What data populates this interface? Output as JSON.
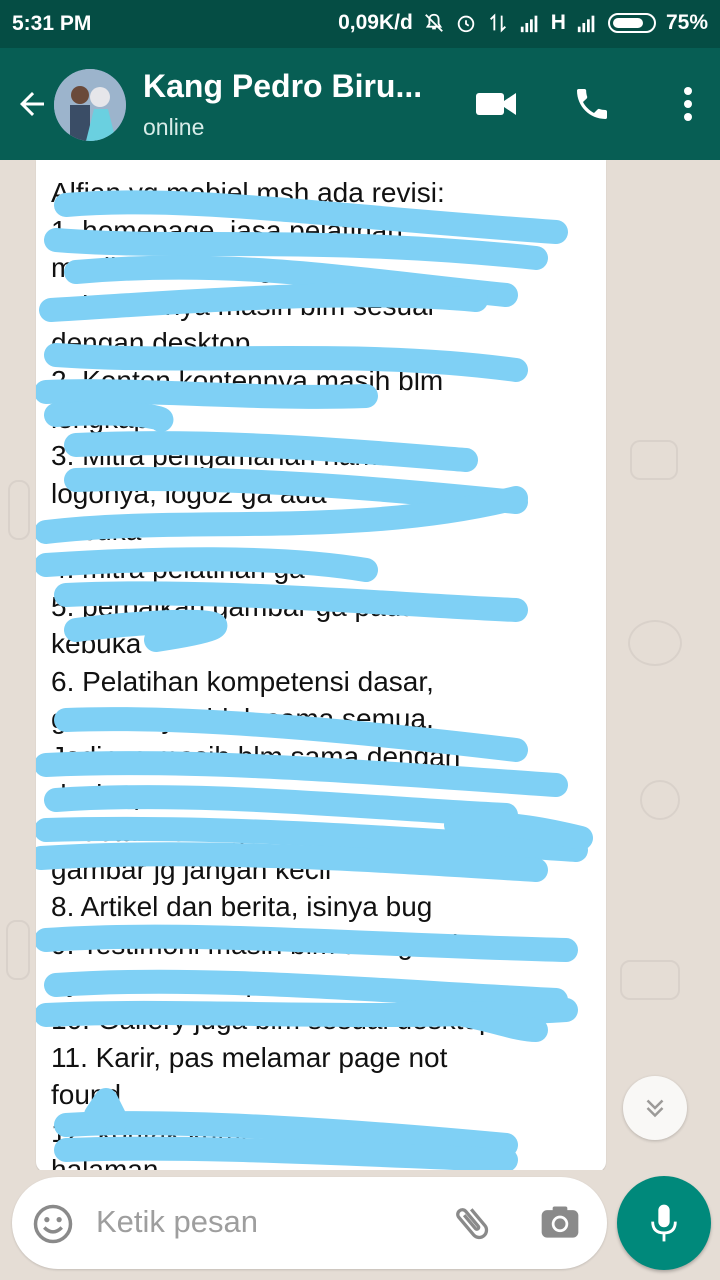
{
  "status_bar": {
    "time": "5:31 PM",
    "network_speed": "0,09K/d",
    "network_type": "H",
    "battery_percent": "75%"
  },
  "header": {
    "contact_name": "Kang Pedro Biru...",
    "status": "online"
  },
  "message": {
    "lines": [
      "Alfian yg mobiel msh ada revisi:",
      "1. homepage, jasa pelatihan",
      "masih ada kurang",
      "pelatihannya masih blm sesuai",
      "dengan desktop",
      "2. Konten kontennya masih blm",
      "lengkap",
      "3. Mitra pengamanan nama",
      "logonya, logo2 ga ada",
      "kebuka",
      "4. mitra pelatihan ga",
      "5. perbaikan gambar ga pada",
      "kebuka",
      "6. Pelatihan kompetensi dasar,",
      "gambarnya tidak sama semua.",
      "Jadinya masih blm sama dengan",
      "desktop",
      "7. detail kelas gambarnya",
      "gambar jg jangan kecil",
      "8. Artikel dan berita, isinya bug",
      "9. Testimoni masih blm ada gambar",
      "nya, cek desktop",
      "10. Gallery juga blm sesuai desktop",
      "11. Karir, pas melamar page not",
      "found",
      "12. kontak kami",
      "halaman"
    ]
  },
  "input": {
    "placeholder": "Ketik pesan"
  },
  "colors": {
    "appbar": "#075e54",
    "statusbar": "#054d44",
    "fab": "#00897b",
    "scribble": "#7fd0f5"
  }
}
